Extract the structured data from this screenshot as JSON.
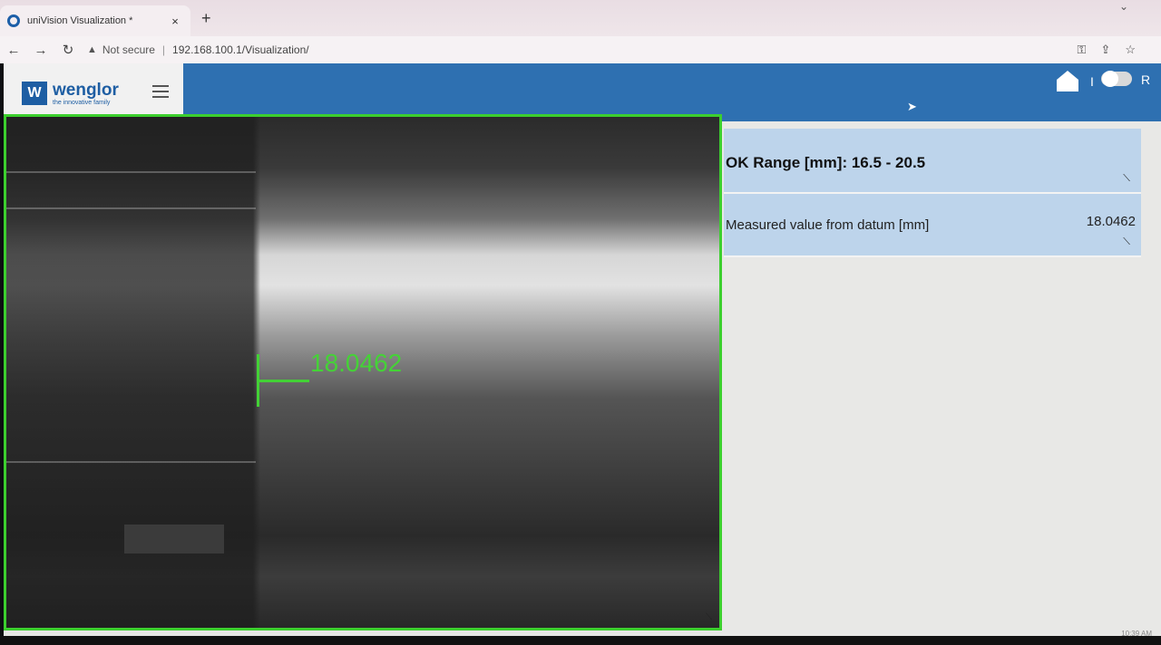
{
  "browser": {
    "tab_title": "uniVision Visualization *",
    "tab_close": "×",
    "new_tab": "+",
    "security_label": "Not secure",
    "url": "192.168.100.1/Visualization/",
    "separator": "|"
  },
  "app": {
    "brand_name": "wenglor",
    "brand_tagline": "the innovative family",
    "brand_logo_glyph": "W",
    "header_separator": "I",
    "header_cut_text": "R",
    "accent_color": "#2e70b1",
    "frame_color": "#3ccf2e"
  },
  "camera": {
    "overlay_value": "18.0462"
  },
  "results": {
    "ok_range": "OK Range [mm]: 16.5 - 20.5",
    "measure_label": "Measured value from datum [mm]",
    "measure_value": "18.0462"
  },
  "taskbar": {
    "clock": "10:39 AM"
  },
  "icons": [
    "back-arrow-icon",
    "forward-arrow-icon",
    "reload-icon",
    "warning-icon",
    "key-icon",
    "share-icon",
    "star-icon",
    "home-icon",
    "toggle-icon",
    "hamburger-icon",
    "resize-icon"
  ]
}
